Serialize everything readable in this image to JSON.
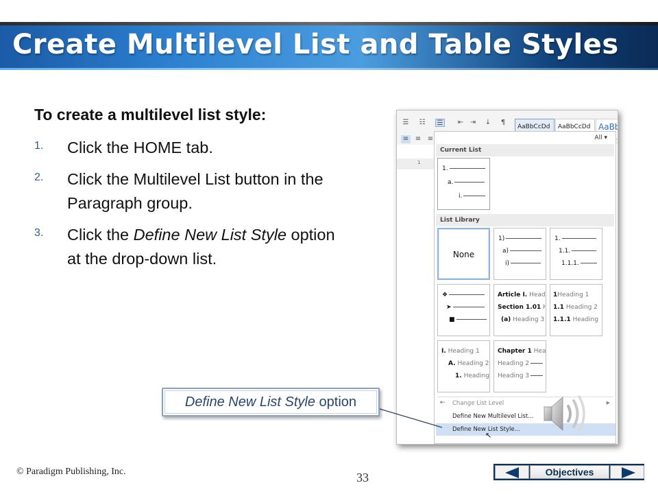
{
  "slide": {
    "title": "Create Multilevel List and Table Styles",
    "heading": "To create a multilevel list style:",
    "steps": [
      {
        "num": "1.",
        "text": "Click the HOME tab."
      },
      {
        "num": "2.",
        "text": "Click the Multilevel List button in the Paragraph group."
      },
      {
        "num": "3.",
        "text_before": "Click the ",
        "text_italic": "Define New List Style",
        "text_after": " option at the drop-down list."
      }
    ],
    "callout": {
      "italic": "Define New List Style",
      "rest": " option"
    },
    "icons": [
      "speaker-icon",
      "nav-prev-arrow-icon",
      "nav-next-arrow-icon"
    ]
  },
  "screenshot": {
    "styles": [
      "AaBbCcDd",
      "AaBbCcDd",
      "AaBb"
    ],
    "ruler_mark": "1",
    "all_label": "All",
    "current_list_header": "Current List",
    "current_list_levels": [
      "1.",
      "a.",
      "i."
    ],
    "list_library_header": "List Library",
    "none_label": "None",
    "library": {
      "numbered_paren": [
        "1)",
        "a)",
        "i)"
      ],
      "numbered_decimal": [
        "1.",
        "1.1.",
        "1.1.1."
      ],
      "article": [
        "Article I.",
        "Head",
        "Section 1.01",
        "H",
        "(a)",
        "Heading 3"
      ],
      "heading_numbered": [
        "1",
        "Heading 1",
        "1.1",
        "Heading 2",
        "1.1.1",
        "Heading"
      ],
      "heading_roman": [
        "I.",
        "Heading 1",
        "A.",
        "Heading 2",
        "1.",
        "Heading"
      ],
      "chapter": [
        "Chapter 1",
        "Hea",
        "Heading 2",
        "Heading 3"
      ]
    },
    "menu": {
      "change_list_level": "Change List Level",
      "define_multilevel": "Define New Multilevel List...",
      "define_list_style": "Define New List Style..."
    }
  },
  "footer": {
    "copyright": "© Paradigm Publishing, Inc.",
    "page": "33",
    "nav_label": "Objectives"
  }
}
